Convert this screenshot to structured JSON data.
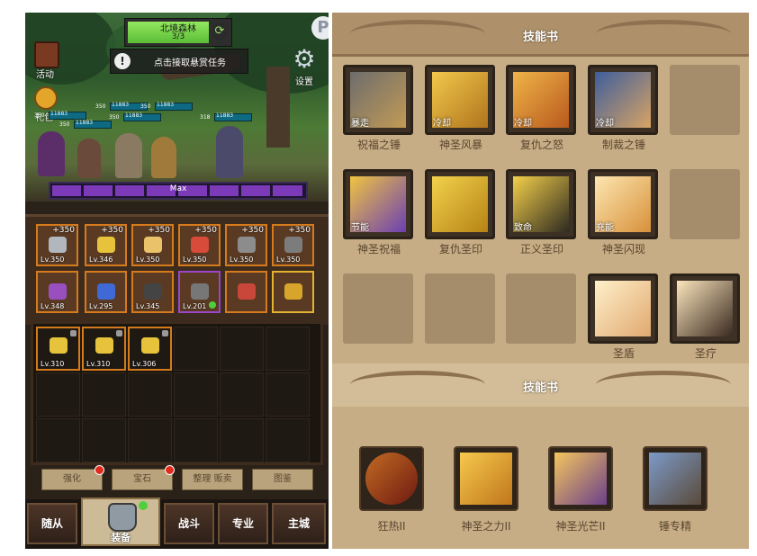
{
  "left_panel": {
    "zone": {
      "name": "北境森林",
      "level": "3/3"
    },
    "task_banner": "点击接取悬赏任务",
    "activity_label": "活动",
    "gift_label": "礼包",
    "settings_label": "设置",
    "corner_badge": "P",
    "unit_bars": [
      {
        "lv": "350",
        "hp": "11883"
      },
      {
        "lv": "350",
        "hp": "11883"
      },
      {
        "lv": "350",
        "hp": "11883"
      },
      {
        "lv": "350",
        "hp": "11883"
      },
      {
        "lv": "350",
        "hp": "11883"
      },
      {
        "lv": "318",
        "hp": "11883"
      }
    ],
    "power_bar": {
      "label": "Max",
      "fill": 1.0
    },
    "equipment": [
      {
        "plus": "+350",
        "level": "Lv.350",
        "border": "orange",
        "icon_color": "#b2b7bd"
      },
      {
        "plus": "+350",
        "level": "Lv.346",
        "border": "orange",
        "icon_color": "#e6c33a"
      },
      {
        "plus": "+350",
        "level": "Lv.350",
        "border": "orange",
        "icon_color": "#e9c26a"
      },
      {
        "plus": "+350",
        "level": "Lv.350",
        "border": "orange",
        "icon_color": "#d84a3a"
      },
      {
        "plus": "+350",
        "level": "Lv.350",
        "border": "orange",
        "icon_color": "#8c8c8c"
      },
      {
        "plus": "+350",
        "level": "Lv.350",
        "border": "orange",
        "icon_color": "#7c7c7c"
      },
      {
        "plus": "",
        "level": "Lv.348",
        "border": "orange",
        "icon_color": "#9a4fbf"
      },
      {
        "plus": "",
        "level": "Lv.295",
        "border": "orange",
        "icon_color": "#3f6ad6"
      },
      {
        "plus": "",
        "level": "Lv.345",
        "border": "orange",
        "icon_color": "#444444"
      },
      {
        "plus": "",
        "level": "Lv.201",
        "border": "purple",
        "icon_color": "#777777"
      },
      {
        "plus": "",
        "level": "",
        "border": "orange",
        "icon_color": "#c9473a"
      },
      {
        "plus": "",
        "level": "",
        "border": "gold",
        "icon_color": "#d8a52c"
      }
    ],
    "inventory": [
      {
        "level": "Lv.310",
        "icon_color": "#e6c33a"
      },
      {
        "level": "Lv.310",
        "icon_color": "#e6c33a"
      },
      {
        "level": "Lv.306",
        "icon_color": "#e6c33a"
      }
    ],
    "tab_buttons": [
      {
        "label": "强化",
        "dot": true
      },
      {
        "label": "宝石",
        "dot": true
      },
      {
        "label": "整理 贩卖",
        "dot": false
      },
      {
        "label": "图鉴",
        "dot": false
      }
    ],
    "bottom_nav": [
      "随从",
      "装备",
      "战斗",
      "专业",
      "主城"
    ]
  },
  "skill_panel_1": {
    "title": "技能书",
    "skills": [
      {
        "name": "祝福之锤",
        "tag": "暴走",
        "colors": [
          "#6d6d6d",
          "#c29a55"
        ]
      },
      {
        "name": "神圣风暴",
        "tag": "冷却",
        "colors": [
          "#f2c84b",
          "#b0741d"
        ]
      },
      {
        "name": "复仇之怒",
        "tag": "冷却",
        "colors": [
          "#f0b448",
          "#b8591d"
        ]
      },
      {
        "name": "制裁之锤",
        "tag": "冷却",
        "colors": [
          "#3e5e9c",
          "#d8a364"
        ]
      },
      {
        "name": "神圣祝福",
        "tag": "节能",
        "colors": [
          "#f0c441",
          "#6b3fb2"
        ]
      },
      {
        "name": "复仇圣印",
        "tag": "",
        "colors": [
          "#f2d24c",
          "#b68314"
        ]
      },
      {
        "name": "正义圣印",
        "tag": "致命",
        "colors": [
          "#f4d04a",
          "#2e2a20"
        ]
      },
      {
        "name": "神圣闪现",
        "tag": "充能",
        "colors": [
          "#fde6b1",
          "#d7913a"
        ]
      },
      {
        "name": "圣盾",
        "tag": "",
        "colors": [
          "#fff0c9",
          "#e0a870"
        ]
      },
      {
        "name": "圣疗",
        "tag": "",
        "colors": [
          "#fbe5bd",
          "#3a2a20"
        ]
      }
    ]
  },
  "skill_panel_2": {
    "title": "技能书",
    "skills": [
      {
        "name": "狂热II",
        "colors": [
          "#c26a22",
          "#6e1a12"
        ]
      },
      {
        "name": "神圣之力II",
        "colors": [
          "#f6c84d",
          "#c0761b"
        ]
      },
      {
        "name": "神圣光芒II",
        "colors": [
          "#f4c65e",
          "#6b3f8a"
        ]
      },
      {
        "name": "锤专精",
        "colors": [
          "#7c9ac8",
          "#5a4a3a"
        ]
      }
    ]
  }
}
